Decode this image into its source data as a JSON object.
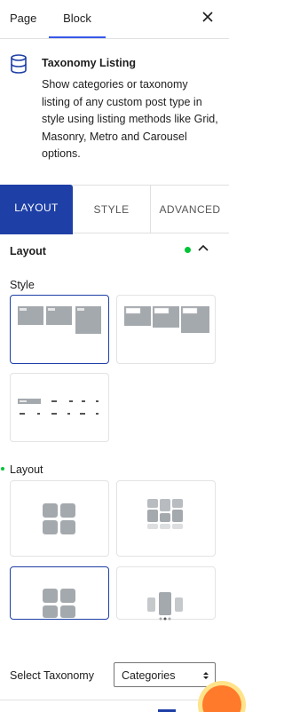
{
  "sidebar_tabs": {
    "page": "Page",
    "block": "Block"
  },
  "block_card": {
    "title": "Taxonomy Listing",
    "description": "Show categories or taxonomy listing of any custom post type in style using listing methods like Grid, Masonry, Metro and Carousel options.",
    "icon": "database-icon"
  },
  "main_tabs": {
    "layout": "LAYOUT",
    "style": "STYLE",
    "advanced": "ADVANCED"
  },
  "panel": {
    "title": "Layout",
    "style_label": "Style",
    "layout_label": "Layout",
    "taxonomy_label": "Select Taxonomy",
    "taxonomy_value": "Categories"
  },
  "colors": {
    "accent": "#1e3fa6",
    "active_dot": "#00c437",
    "tile": "#a4a9ae"
  }
}
